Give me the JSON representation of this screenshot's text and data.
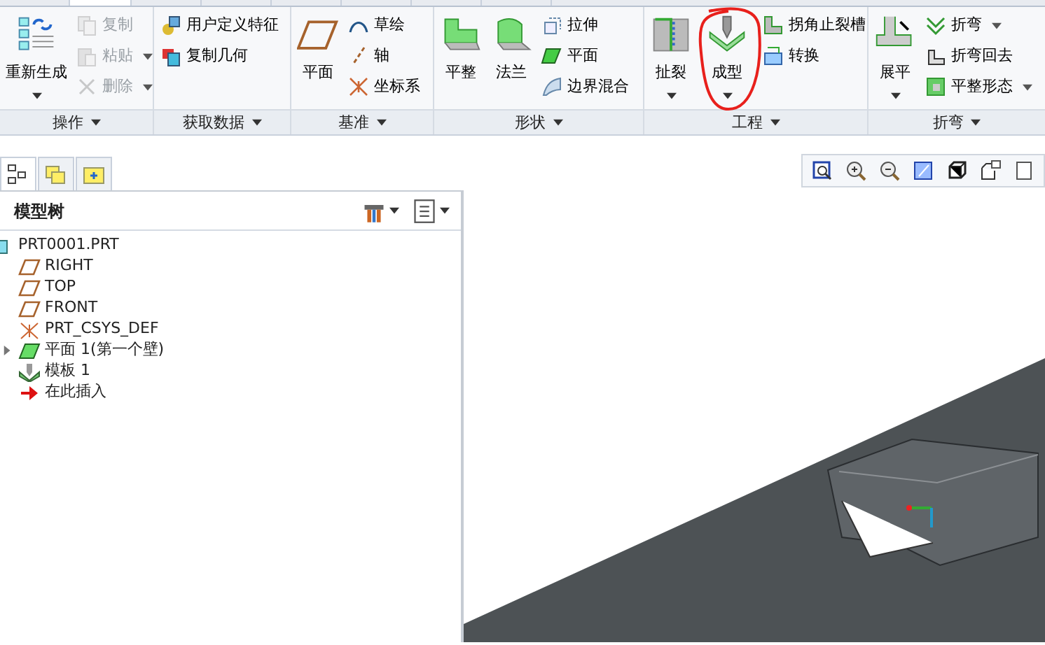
{
  "ribbon": {
    "tabs": [
      {
        "selected": false
      },
      {
        "selected": true
      },
      {
        "selected": false
      },
      {
        "selected": false
      },
      {
        "selected": false
      },
      {
        "selected": false
      },
      {
        "selected": false
      },
      {
        "selected": false
      }
    ],
    "groups": [
      {
        "label": "操作",
        "items": [
          {
            "kind": "large",
            "label": "重新生成",
            "dropdown": true,
            "disabled": false
          },
          {
            "kind": "small",
            "label": "复制",
            "dropdown": false,
            "disabled": true
          },
          {
            "kind": "small",
            "label": "粘贴",
            "dropdown": true,
            "disabled": true
          },
          {
            "kind": "small",
            "label": "删除",
            "dropdown": true,
            "disabled": true
          }
        ]
      },
      {
        "label": "获取数据",
        "items": [
          {
            "kind": "small",
            "label": "用户定义特征",
            "dropdown": false,
            "disabled": false
          },
          {
            "kind": "small",
            "label": "复制几何",
            "dropdown": false,
            "disabled": false
          }
        ]
      },
      {
        "label": "基准",
        "items": [
          {
            "kind": "large",
            "label": "平面",
            "dropdown": false,
            "disabled": false
          },
          {
            "kind": "small",
            "label": "草绘",
            "dropdown": false,
            "disabled": false
          },
          {
            "kind": "small",
            "label": "轴",
            "dropdown": false,
            "disabled": false
          },
          {
            "kind": "small",
            "label": "坐标系",
            "dropdown": false,
            "disabled": false
          }
        ]
      },
      {
        "label": "形状",
        "items": [
          {
            "kind": "large",
            "label": "平整",
            "dropdown": false,
            "disabled": false
          },
          {
            "kind": "large",
            "label": "法兰",
            "dropdown": false,
            "disabled": false
          },
          {
            "kind": "small",
            "label": "拉伸",
            "dropdown": false,
            "disabled": false
          },
          {
            "kind": "small",
            "label": "平面",
            "dropdown": false,
            "disabled": false
          },
          {
            "kind": "small",
            "label": "边界混合",
            "dropdown": false,
            "disabled": false
          }
        ]
      },
      {
        "label": "工程",
        "items": [
          {
            "kind": "large",
            "label": "扯裂",
            "dropdown": true,
            "disabled": false
          },
          {
            "kind": "large",
            "label": "成型",
            "dropdown": true,
            "disabled": false,
            "circled": true
          },
          {
            "kind": "small",
            "label": "拐角止裂槽",
            "dropdown": false,
            "disabled": false
          },
          {
            "kind": "small",
            "label": "转换",
            "dropdown": false,
            "disabled": false
          }
        ]
      },
      {
        "label": "折弯",
        "items": [
          {
            "kind": "large",
            "label": "展平",
            "dropdown": true,
            "disabled": false
          },
          {
            "kind": "small",
            "label": "折弯",
            "dropdown": true,
            "disabled": false
          },
          {
            "kind": "small",
            "label": "折弯回去",
            "dropdown": false,
            "disabled": false
          },
          {
            "kind": "small",
            "label": "平整形态",
            "dropdown": true,
            "disabled": false
          }
        ]
      }
    ]
  },
  "navigator": {
    "tabs": [
      {
        "selected": true
      },
      {
        "selected": false
      },
      {
        "selected": false
      }
    ],
    "title": "模型树",
    "tree": [
      {
        "kind": "part",
        "label": "PRT0001.PRT"
      },
      {
        "kind": "plane",
        "label": "RIGHT"
      },
      {
        "kind": "plane",
        "label": "TOP"
      },
      {
        "kind": "plane",
        "label": "FRONT"
      },
      {
        "kind": "csys",
        "label": "PRT_CSYS_DEF"
      },
      {
        "kind": "wall",
        "label": "平面 1(第一个壁)",
        "expanded": false
      },
      {
        "kind": "form",
        "label": "模板 1"
      },
      {
        "kind": "insert",
        "label": "在此插入"
      }
    ]
  }
}
